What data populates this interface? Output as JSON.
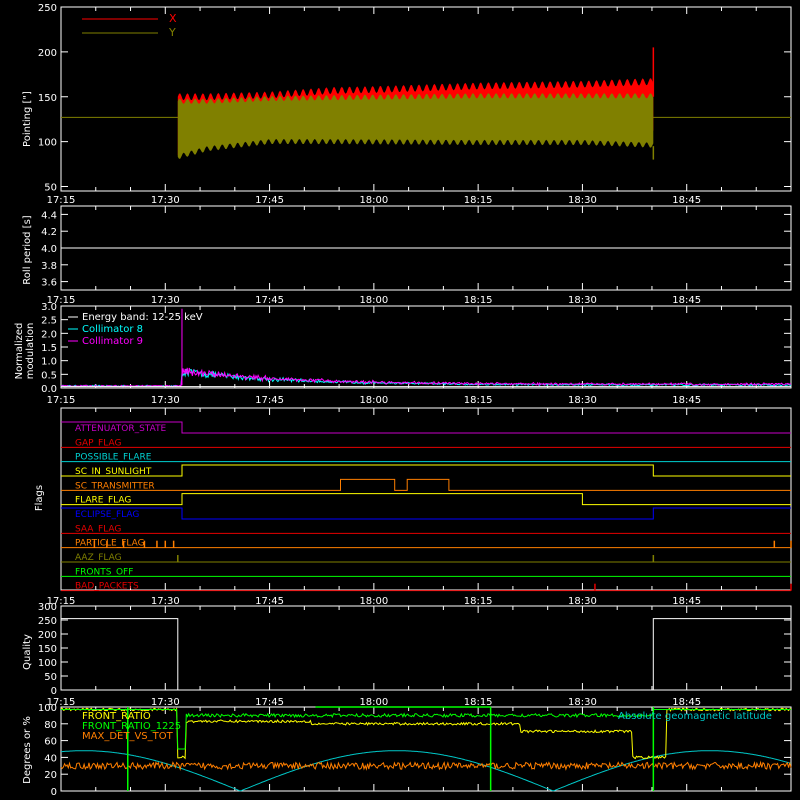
{
  "time_ticks": [
    "17:15",
    "17:30",
    "17:45",
    "18:00",
    "18:15",
    "18:30",
    "18:45"
  ],
  "colors": {
    "axis": "#ffffff",
    "x_series": "#ff0000",
    "y_series": "#808000",
    "collimator8": "#00ffff",
    "collimator9": "#ff00ff",
    "front_ratio": "#ffff00",
    "front_ratio_1225": "#00ff00",
    "max_det_vs_tot": "#ff7f00",
    "latitude": "#00c8c8"
  },
  "chart_data": [
    {
      "type": "area",
      "ylabel": "Pointing [\"]",
      "ylim": [
        45,
        250
      ],
      "yticks": [
        "50",
        "100",
        "150",
        "200",
        "250"
      ],
      "series": [
        {
          "name": "X",
          "color": "#ff0000",
          "envelope": [
            [
              17.53,
              150,
              85
            ],
            [
              17.6,
              150,
              97
            ],
            [
              17.75,
              152,
              108
            ],
            [
              17.9,
              157,
              110
            ],
            [
              18.0,
              158,
              111
            ],
            [
              18.25,
              162,
              112
            ],
            [
              18.5,
              164,
              112
            ],
            [
              18.67,
              167,
              110
            ]
          ]
        },
        {
          "name": "Y",
          "color": "#808000",
          "envelope": [
            [
              17.53,
              145,
              83
            ],
            [
              17.6,
              145,
              92
            ],
            [
              17.75,
              148,
              100
            ],
            [
              17.9,
              149,
              100
            ],
            [
              18.25,
              151,
              99
            ],
            [
              18.5,
              151,
              99
            ],
            [
              18.67,
              151,
              96
            ]
          ]
        }
      ],
      "reference_level": 127,
      "end_spike": 205
    },
    {
      "type": "line",
      "ylabel": "Roll period [s]",
      "ylim": [
        3.5,
        4.5
      ],
      "yticks": [
        "3.6",
        "3.8",
        "4.0",
        "4.2",
        "4.4"
      ],
      "value": 4.0
    },
    {
      "type": "line",
      "ylabel": "Normalized\nmodulation",
      "ylim": [
        0,
        3.0
      ],
      "yticks": [
        "0.0",
        "0.5",
        "1.0",
        "1.5",
        "2.0",
        "2.5",
        "3.0"
      ],
      "annotations": [
        "Energy band: 12-25 keV"
      ],
      "series": [
        {
          "name": "Collimator 8",
          "color": "#00ffff"
        },
        {
          "name": "Collimator 9",
          "color": "#ff00ff"
        }
      ],
      "spike_time": 17.54,
      "spike_value": 2.9
    },
    {
      "type": "line",
      "ylabel": "Flags",
      "flags": [
        {
          "name": "ATTENUATOR_STATE",
          "color": "#c800c8",
          "segments": [
            [
              17.25,
              17.54,
              1
            ],
            [
              17.54,
              19.0,
              0
            ]
          ]
        },
        {
          "name": "GAP_FLAG",
          "color": "#e60000",
          "segments": [
            [
              17.25,
              19.0,
              0
            ]
          ]
        },
        {
          "name": "POSSIBLE_FLARE",
          "color": "#00d2d2",
          "segments": [
            [
              17.25,
              19.0,
              0
            ]
          ]
        },
        {
          "name": "SC_IN_SUNLIGHT",
          "color": "#ffff00",
          "segments": [
            [
              17.25,
              17.54,
              0
            ],
            [
              17.54,
              18.67,
              1
            ],
            [
              18.67,
              19.0,
              0
            ]
          ]
        },
        {
          "name": "SC_TRANSMITTER",
          "color": "#ff7f00",
          "segments": [
            [
              17.25,
              17.92,
              0
            ],
            [
              17.92,
              18.05,
              1
            ],
            [
              18.05,
              18.08,
              0
            ],
            [
              18.08,
              18.18,
              1
            ],
            [
              18.18,
              19.0,
              0
            ]
          ]
        },
        {
          "name": "FLARE_FLAG",
          "color": "#ffff00",
          "segments": [
            [
              17.25,
              17.54,
              0
            ],
            [
              17.54,
              18.5,
              1
            ],
            [
              18.5,
              19.0,
              0
            ]
          ]
        },
        {
          "name": "ECLIPSE_FLAG",
          "color": "#0000ff",
          "segments": [
            [
              17.25,
              17.54,
              1
            ],
            [
              17.54,
              18.67,
              0
            ],
            [
              18.67,
              19.0,
              1
            ]
          ]
        },
        {
          "name": "SAA_FLAG",
          "color": "#e60000",
          "segments": [
            [
              17.25,
              19.0,
              0
            ]
          ]
        },
        {
          "name": "PARTICLE_FLAG",
          "color": "#ff7f00",
          "segments": [
            [
              17.25,
              19.0,
              0
            ]
          ],
          "spikes": [
            17.33,
            17.36,
            17.4,
            17.45,
            17.48,
            17.5,
            17.52,
            18.96,
            19.0
          ]
        },
        {
          "name": "AAZ_FLAG",
          "color": "#808000",
          "segments": [
            [
              17.25,
              19.0,
              0
            ]
          ],
          "spikes": [
            17.53,
            18.67
          ]
        },
        {
          "name": "FRONTS_OFF",
          "color": "#00ff00",
          "segments": [
            [
              17.25,
              19.0,
              0
            ]
          ]
        },
        {
          "name": "BAD_PACKETS",
          "color": "#e60000",
          "segments": [
            [
              17.25,
              19.0,
              0
            ]
          ],
          "spikes": [
            18.53,
            19.0
          ]
        }
      ]
    },
    {
      "type": "line",
      "ylabel": "Quality",
      "ylim": [
        0,
        300
      ],
      "yticks": [
        "0",
        "50",
        "100",
        "150",
        "200",
        "250",
        "300"
      ],
      "segments": [
        [
          17.25,
          17.53,
          255
        ],
        [
          17.53,
          18.67,
          0
        ],
        [
          18.67,
          19.0,
          255
        ]
      ]
    },
    {
      "type": "line",
      "ylabel": "Degrees or %",
      "ylim": [
        0,
        100
      ],
      "yticks": [
        "0",
        "20",
        "40",
        "60",
        "80",
        "100"
      ],
      "series": [
        {
          "name": "FRONT_RATIO",
          "color": "#ffff00"
        },
        {
          "name": "FRONT_RATIO_1225",
          "color": "#00ff00"
        },
        {
          "name": "MAX_DET_VS_TOT",
          "color": "#ff7f00"
        }
      ],
      "annotations": [
        "Absolute geomagnetic latitude"
      ]
    }
  ]
}
